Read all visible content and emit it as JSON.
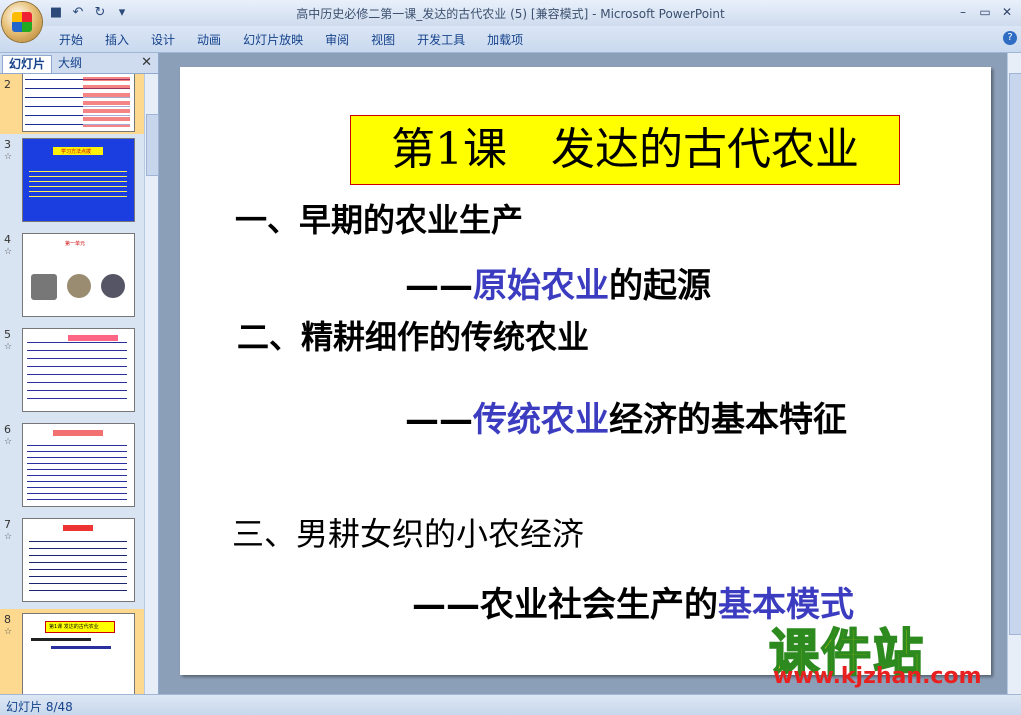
{
  "window": {
    "title": "高中历史必修二第一课_发达的古代农业 (5) [兼容模式] - Microsoft PowerPoint",
    "controls": [
      "minimize-icon",
      "restore-icon",
      "close-icon"
    ]
  },
  "qat": [
    "save-icon",
    "undo-icon",
    "redo-icon",
    "customize-icon"
  ],
  "ribbon": {
    "tabs": [
      "开始",
      "插入",
      "设计",
      "动画",
      "幻灯片放映",
      "审阅",
      "视图",
      "开发工具",
      "加载项"
    ]
  },
  "panel": {
    "tabs": [
      "幻灯片",
      "大纲"
    ],
    "thumbnails": [
      {
        "number": "2",
        "selected": false
      },
      {
        "number": "3",
        "selected": false,
        "anim": "☆",
        "title": "学习方法点拨"
      },
      {
        "number": "4",
        "selected": false,
        "anim": "☆",
        "title": "第一单元"
      },
      {
        "number": "5",
        "selected": false,
        "anim": "☆"
      },
      {
        "number": "6",
        "selected": false,
        "anim": "☆"
      },
      {
        "number": "7",
        "selected": false,
        "anim": "☆"
      },
      {
        "number": "8",
        "selected": true,
        "anim": "☆",
        "title": "第1课 发达的古代农业"
      }
    ]
  },
  "slide": {
    "title": "第1课　发达的古代农业",
    "lines": [
      {
        "text": "一、早期的农业生产"
      },
      {
        "prefix": "——",
        "accent": "原始农业",
        "suffix": "的起源"
      },
      {
        "text": "二、精耕细作的传统农业"
      },
      {
        "prefix": "——",
        "accent": "传统农业",
        "suffix": "经济的基本特征"
      },
      {
        "text": "三、男耕女织的小农经济"
      },
      {
        "prefix": "——",
        "plain": "农业社会生产的",
        "accent": "基本模式"
      }
    ]
  },
  "watermark": {
    "main": "课件站",
    "url": "www.kjzhan.com"
  },
  "status": {
    "slide_counter": "幻灯片 8/48"
  },
  "colors": {
    "accent": "#3c3cc0",
    "title_bg": "#ffff00",
    "selected_thumb": "#fcd98f"
  }
}
